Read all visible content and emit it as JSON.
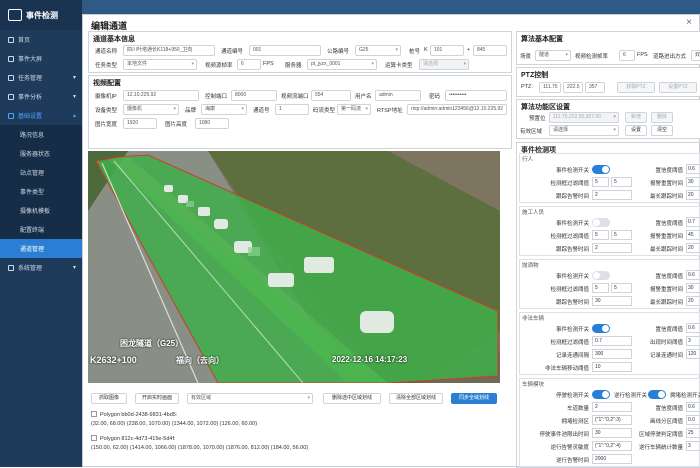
{
  "app": {
    "title": "事件检测"
  },
  "sidebar": {
    "items": [
      {
        "label": "首页"
      },
      {
        "label": "事件大屏"
      },
      {
        "label": "任务管理"
      },
      {
        "label": "事件分析"
      },
      {
        "label": "基础设置"
      }
    ],
    "sub": [
      {
        "label": "路况信息"
      },
      {
        "label": "服务器状态"
      },
      {
        "label": "站点管理"
      },
      {
        "label": "事件类型"
      },
      {
        "label": "摄像机模板"
      },
      {
        "label": "配置终端"
      },
      {
        "label": "通道管理"
      }
    ],
    "last": {
      "label": "系统管理"
    }
  },
  "modal": {
    "title": "编辑通道",
    "close": "×"
  },
  "basic": {
    "title": "通道基本信息",
    "name_label": "通道名称",
    "name_value": "四川叶塔通长K118+950_卫向",
    "no_label": "通道编号",
    "no_value": "001",
    "road_label": "公路编号",
    "road_value": "G25",
    "pile_label": "桩号",
    "pile_k": "K",
    "pile_a": "101",
    "pile_plus": "+",
    "pile_b": "845",
    "task_label": "任务类型",
    "task_value": "本地文件",
    "fps_label": "视频源帧率",
    "fps_value": "6",
    "fps_unit": "FPS",
    "server_label": "服务器",
    "server_value": "pt_jyzx_0001",
    "card_label": "运算卡类型",
    "card_value": "请选择"
  },
  "video_cfg": {
    "title": "视频配置",
    "ip_label": "摄像机IP",
    "ip_value": "12.10.225.92",
    "port_label": "控制端口",
    "port_value": "8000",
    "stream_port_label": "视频流端口",
    "stream_port_value": "554",
    "user_label": "用户名",
    "user_value": "admin",
    "pwd_label": "密码",
    "pwd_value": "••••••••••",
    "dev_label": "设备类型",
    "dev_value": "摄像机",
    "brand_label": "品牌",
    "brand_value": "海康",
    "ch_label": "通道号",
    "ch_value": "1",
    "code_label": "码流类型",
    "code_value": "第一码流",
    "rtsp_label": "RTSP地址",
    "rtsp_value": "rtsp://admin:admin123456@12.10.225.92",
    "w_label": "图片宽度",
    "w_value": "1920",
    "h_label": "图片高度",
    "h_value": "1080"
  },
  "overlay": {
    "road": "困龙隧道（G25）",
    "pile": "K2632+100",
    "dir": "福向（去向）",
    "time": "2022-12-16  14:17:23"
  },
  "actions": {
    "capture": "抓取图像",
    "realtime": "开启实时画面",
    "region_placeholder": "有效区域",
    "del_sel": "删除选中区域划线",
    "clear": "清除全部区域划线",
    "sync": "同步全域划线"
  },
  "polygons": [
    {
      "name": "Polygon bb0d-2438-9831-4bd5:",
      "coords": "(32.00, 68.00) (238.00, 1070.00) (1344.00, 1072.00) (126.00, 60.00)"
    },
    {
      "name": "Polygon 812c-4d73-415e-5d4f:",
      "coords": "(150.00, 62.00) (1414.00, 1066.00) (1878.00, 1070.00) (1876.00, 812.00) (184.00, 56.00)"
    }
  ],
  "algo_basic": {
    "title": "算法基本配置",
    "scene_label": "场景",
    "scene_value": "隧道",
    "fps_label": "视频检测帧率",
    "fps_value": "6",
    "fps_unit": "FPS",
    "mode_label": "道路进出方式",
    "mode_value": "双"
  },
  "ptz": {
    "title": "PTZ控制",
    "label": "PTZ:",
    "p": "111.75",
    "t": "222.5",
    "z": "357",
    "b1": "获取PTZ",
    "b2": "设置PTZ"
  },
  "algo_func": {
    "title": "算法功能区设置",
    "preset_label": "预置位",
    "preset_value": "111.75,222.50,357.00",
    "b1": "新增",
    "b2": "删除",
    "area_label": "有效区域",
    "area_value": "请选择",
    "b3": "设置",
    "b4": "清空"
  },
  "events": {
    "title": "事件检测项",
    "groups": [
      {
        "name": "行人",
        "rows": [
          {
            "k": "事件检测开关",
            "sw": true,
            "k2": "置信度阈值",
            "vv": "0.6"
          },
          {
            "k": "检测框过滤阈值",
            "v": "5",
            "v2": "5",
            "k2": "报警重置时间",
            "vv": "30"
          },
          {
            "k": "跟踪告警时间",
            "v": "2",
            "k2": "最长跟踪时间",
            "vv": "20"
          }
        ]
      },
      {
        "name": "施工人员",
        "rows": [
          {
            "k": "事件检测开关",
            "sw": false,
            "k2": "置信度阈值",
            "vv": "0.7"
          },
          {
            "k": "检测框过滤阈值",
            "v": "5",
            "v2": "5",
            "k2": "报警重置时间",
            "vv": "45"
          },
          {
            "k": "跟踪告警时间",
            "v": "2",
            "k2": "最长跟踪时间",
            "vv": "20"
          }
        ]
      },
      {
        "name": "抛洒物",
        "rows": [
          {
            "k": "事件检测开关",
            "sw": false,
            "k2": "置信度阈值",
            "vv": "0.6"
          },
          {
            "k": "检测框过滤阈值",
            "v": "5",
            "v2": "5",
            "k2": "报警重置时间",
            "vv": "30"
          },
          {
            "k": "跟踪告警时间",
            "v": "30",
            "k2": "最长跟踪时间",
            "vv": "20"
          }
        ]
      },
      {
        "name": "非法车辆",
        "rows": [
          {
            "k": "事件检测开关",
            "sw": true,
            "k2": "置信度阈值",
            "vv": "0.6"
          },
          {
            "k": "检测框过滤阈值",
            "v": "0.7",
            "k2": "出现时间阈值",
            "vv": "3"
          },
          {
            "k": "记录连通间隔",
            "v": "300",
            "k2": "记录连通时间",
            "vv": "120"
          },
          {
            "k": "非法车辆移动阈值",
            "v": "10"
          }
        ]
      },
      {
        "name": "车辆模块",
        "rows": [
          {
            "k": "停驶检测开关",
            "sw": true,
            "k3": "逆行检测开关",
            "sw2": true,
            "k2": "拥堵检测开关",
            "vv": ""
          },
          {
            "k": "车道数量",
            "v": "2",
            "k2": "置信度阈值",
            "vv": "0.6"
          },
          {
            "k": "拥堵检测区",
            "v": "(\"1\":\"0,2\":3)",
            "k2": "画线分区阈值",
            "vv": "0.0"
          },
          {
            "k": "停驶事件池限出时间",
            "v": "30",
            "k2": "区域停驶判定阈值",
            "vv": "25"
          },
          {
            "k": "逆行告警灵敏度",
            "v": "(\"1\":\"0,2\":4)",
            "k2": "逆行车辆统计数量",
            "vv": "3"
          },
          {
            "k": "逆行告警时间",
            "v": "2000",
            "k2": "",
            "vv": ""
          }
        ]
      }
    ]
  }
}
